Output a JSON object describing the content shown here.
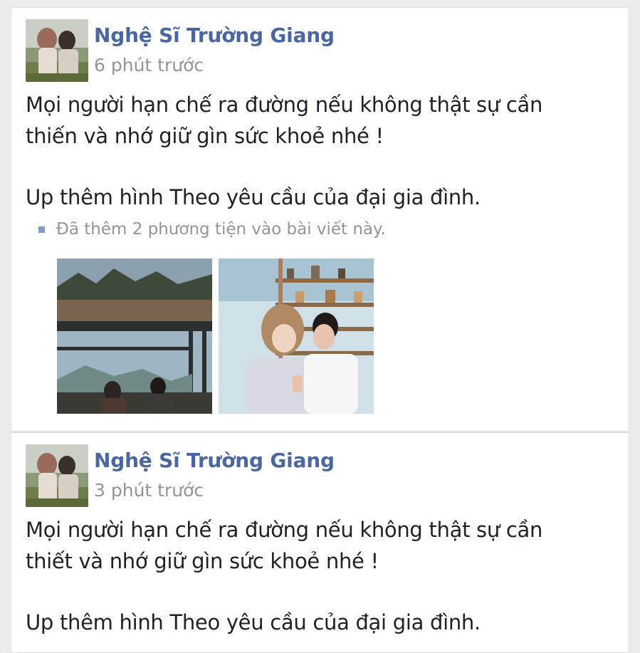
{
  "posts": [
    {
      "author": "Nghệ Sĩ Trường Giang",
      "time": "6 phút trước",
      "text_lines": [
        "Mọi người hạn chế ra đường nếu không thật sự cần",
        "thiến và nhớ giữ gìn sức khoẻ nhé !"
      ],
      "text_extra": "Up thêm hình Theo yêu cầu của đại gia đình.",
      "media_note": "Đã thêm 2 phương tiện vào bài viết này."
    },
    {
      "author": "Nghệ Sĩ Trường Giang",
      "time": "3 phút trước",
      "text_lines": [
        "Mọi người hạn chế ra đường nếu không thật sự cần",
        "thiết và nhớ giữ gìn sức khoẻ nhé !"
      ],
      "text_extra": "Up thêm hình Theo yêu cầu của đại gia đình."
    }
  ],
  "colors": {
    "author_name": "#4b67a1",
    "timestamp": "#90949c",
    "body_text": "#1d2129",
    "background": "#e9ebee"
  },
  "icons": {
    "media_note": "square-bullet-icon"
  }
}
